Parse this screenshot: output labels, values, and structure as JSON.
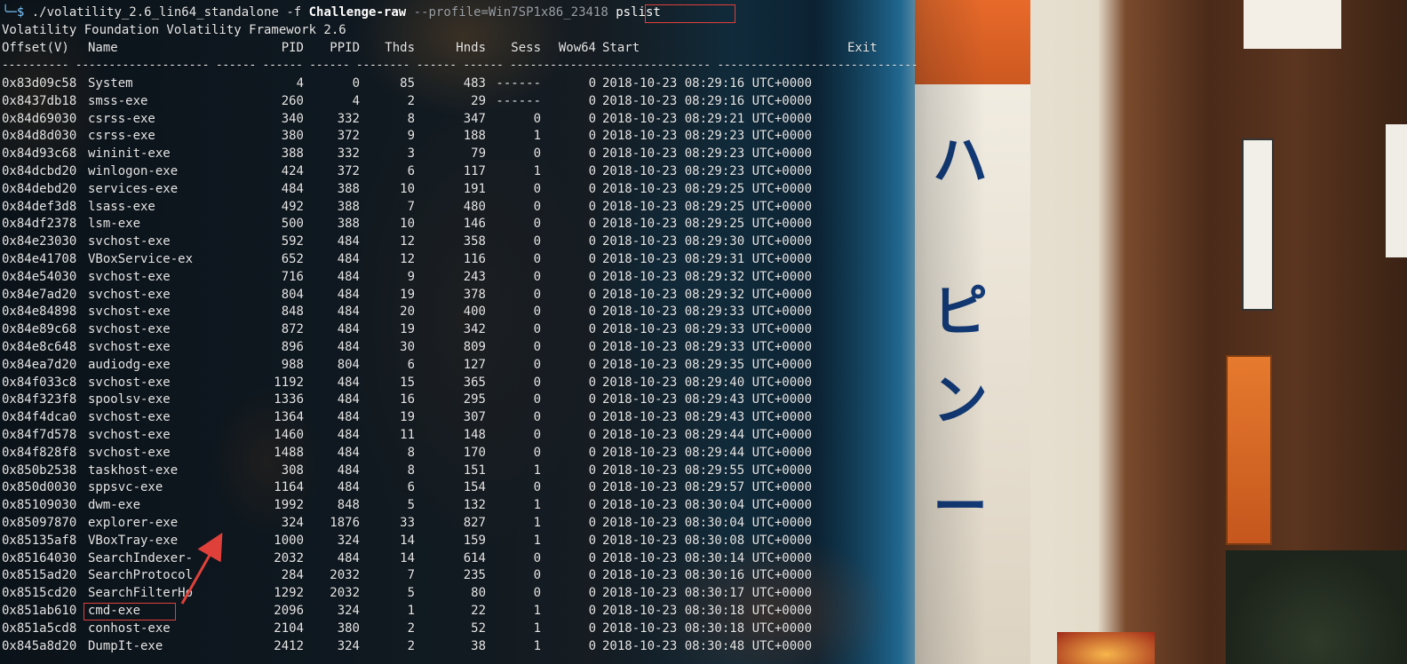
{
  "prompt": {
    "symbol": "╰─$",
    "executable": "./volatility_2.6_lin64_standalone",
    "flag_f": "-f",
    "file": "Challenge-raw",
    "profile_arg": "--profile=Win7SP1x86_23418",
    "plugin": "pslist"
  },
  "banner": "Volatility Foundation Volatility Framework 2.6",
  "headers": {
    "offset": "Offset(V)",
    "name": "Name",
    "pid": "PID",
    "ppid": "PPID",
    "thds": "Thds",
    "hnds": "Hnds",
    "sess": "Sess",
    "wow64": "Wow64",
    "start": "Start",
    "exit": "Exit"
  },
  "separator": "---------- -------------------- ------ ------ ------ -------- ------ ------ ------------------------------ ------------------------------",
  "processes": [
    {
      "offset": "0x83d09c58",
      "name": "System",
      "pid": "4",
      "ppid": "0",
      "thds": "85",
      "hnds": "483",
      "sess": "------",
      "wow64": "0",
      "start": "2018-10-23 08:29:16 UTC+0000"
    },
    {
      "offset": "0x8437db18",
      "name": "smss-exe",
      "pid": "260",
      "ppid": "4",
      "thds": "2",
      "hnds": "29",
      "sess": "------",
      "wow64": "0",
      "start": "2018-10-23 08:29:16 UTC+0000"
    },
    {
      "offset": "0x84d69030",
      "name": "csrss-exe",
      "pid": "340",
      "ppid": "332",
      "thds": "8",
      "hnds": "347",
      "sess": "0",
      "wow64": "0",
      "start": "2018-10-23 08:29:21 UTC+0000"
    },
    {
      "offset": "0x84d8d030",
      "name": "csrss-exe",
      "pid": "380",
      "ppid": "372",
      "thds": "9",
      "hnds": "188",
      "sess": "1",
      "wow64": "0",
      "start": "2018-10-23 08:29:23 UTC+0000"
    },
    {
      "offset": "0x84d93c68",
      "name": "wininit-exe",
      "pid": "388",
      "ppid": "332",
      "thds": "3",
      "hnds": "79",
      "sess": "0",
      "wow64": "0",
      "start": "2018-10-23 08:29:23 UTC+0000"
    },
    {
      "offset": "0x84dcbd20",
      "name": "winlogon-exe",
      "pid": "424",
      "ppid": "372",
      "thds": "6",
      "hnds": "117",
      "sess": "1",
      "wow64": "0",
      "start": "2018-10-23 08:29:23 UTC+0000"
    },
    {
      "offset": "0x84debd20",
      "name": "services-exe",
      "pid": "484",
      "ppid": "388",
      "thds": "10",
      "hnds": "191",
      "sess": "0",
      "wow64": "0",
      "start": "2018-10-23 08:29:25 UTC+0000"
    },
    {
      "offset": "0x84def3d8",
      "name": "lsass-exe",
      "pid": "492",
      "ppid": "388",
      "thds": "7",
      "hnds": "480",
      "sess": "0",
      "wow64": "0",
      "start": "2018-10-23 08:29:25 UTC+0000"
    },
    {
      "offset": "0x84df2378",
      "name": "lsm-exe",
      "pid": "500",
      "ppid": "388",
      "thds": "10",
      "hnds": "146",
      "sess": "0",
      "wow64": "0",
      "start": "2018-10-23 08:29:25 UTC+0000"
    },
    {
      "offset": "0x84e23030",
      "name": "svchost-exe",
      "pid": "592",
      "ppid": "484",
      "thds": "12",
      "hnds": "358",
      "sess": "0",
      "wow64": "0",
      "start": "2018-10-23 08:29:30 UTC+0000"
    },
    {
      "offset": "0x84e41708",
      "name": "VBoxService-ex",
      "pid": "652",
      "ppid": "484",
      "thds": "12",
      "hnds": "116",
      "sess": "0",
      "wow64": "0",
      "start": "2018-10-23 08:29:31 UTC+0000"
    },
    {
      "offset": "0x84e54030",
      "name": "svchost-exe",
      "pid": "716",
      "ppid": "484",
      "thds": "9",
      "hnds": "243",
      "sess": "0",
      "wow64": "0",
      "start": "2018-10-23 08:29:32 UTC+0000"
    },
    {
      "offset": "0x84e7ad20",
      "name": "svchost-exe",
      "pid": "804",
      "ppid": "484",
      "thds": "19",
      "hnds": "378",
      "sess": "0",
      "wow64": "0",
      "start": "2018-10-23 08:29:32 UTC+0000"
    },
    {
      "offset": "0x84e84898",
      "name": "svchost-exe",
      "pid": "848",
      "ppid": "484",
      "thds": "20",
      "hnds": "400",
      "sess": "0",
      "wow64": "0",
      "start": "2018-10-23 08:29:33 UTC+0000"
    },
    {
      "offset": "0x84e89c68",
      "name": "svchost-exe",
      "pid": "872",
      "ppid": "484",
      "thds": "19",
      "hnds": "342",
      "sess": "0",
      "wow64": "0",
      "start": "2018-10-23 08:29:33 UTC+0000"
    },
    {
      "offset": "0x84e8c648",
      "name": "svchost-exe",
      "pid": "896",
      "ppid": "484",
      "thds": "30",
      "hnds": "809",
      "sess": "0",
      "wow64": "0",
      "start": "2018-10-23 08:29:33 UTC+0000"
    },
    {
      "offset": "0x84ea7d20",
      "name": "audiodg-exe",
      "pid": "988",
      "ppid": "804",
      "thds": "6",
      "hnds": "127",
      "sess": "0",
      "wow64": "0",
      "start": "2018-10-23 08:29:35 UTC+0000"
    },
    {
      "offset": "0x84f033c8",
      "name": "svchost-exe",
      "pid": "1192",
      "ppid": "484",
      "thds": "15",
      "hnds": "365",
      "sess": "0",
      "wow64": "0",
      "start": "2018-10-23 08:29:40 UTC+0000"
    },
    {
      "offset": "0x84f323f8",
      "name": "spoolsv-exe",
      "pid": "1336",
      "ppid": "484",
      "thds": "16",
      "hnds": "295",
      "sess": "0",
      "wow64": "0",
      "start": "2018-10-23 08:29:43 UTC+0000"
    },
    {
      "offset": "0x84f4dca0",
      "name": "svchost-exe",
      "pid": "1364",
      "ppid": "484",
      "thds": "19",
      "hnds": "307",
      "sess": "0",
      "wow64": "0",
      "start": "2018-10-23 08:29:43 UTC+0000"
    },
    {
      "offset": "0x84f7d578",
      "name": "svchost-exe",
      "pid": "1460",
      "ppid": "484",
      "thds": "11",
      "hnds": "148",
      "sess": "0",
      "wow64": "0",
      "start": "2018-10-23 08:29:44 UTC+0000"
    },
    {
      "offset": "0x84f828f8",
      "name": "svchost-exe",
      "pid": "1488",
      "ppid": "484",
      "thds": "8",
      "hnds": "170",
      "sess": "0",
      "wow64": "0",
      "start": "2018-10-23 08:29:44 UTC+0000"
    },
    {
      "offset": "0x850b2538",
      "name": "taskhost-exe",
      "pid": "308",
      "ppid": "484",
      "thds": "8",
      "hnds": "151",
      "sess": "1",
      "wow64": "0",
      "start": "2018-10-23 08:29:55 UTC+0000"
    },
    {
      "offset": "0x850d0030",
      "name": "sppsvc-exe",
      "pid": "1164",
      "ppid": "484",
      "thds": "6",
      "hnds": "154",
      "sess": "0",
      "wow64": "0",
      "start": "2018-10-23 08:29:57 UTC+0000"
    },
    {
      "offset": "0x85109030",
      "name": "dwm-exe",
      "pid": "1992",
      "ppid": "848",
      "thds": "5",
      "hnds": "132",
      "sess": "1",
      "wow64": "0",
      "start": "2018-10-23 08:30:04 UTC+0000"
    },
    {
      "offset": "0x85097870",
      "name": "explorer-exe",
      "pid": "324",
      "ppid": "1876",
      "thds": "33",
      "hnds": "827",
      "sess": "1",
      "wow64": "0",
      "start": "2018-10-23 08:30:04 UTC+0000"
    },
    {
      "offset": "0x85135af8",
      "name": "VBoxTray-exe",
      "pid": "1000",
      "ppid": "324",
      "thds": "14",
      "hnds": "159",
      "sess": "1",
      "wow64": "0",
      "start": "2018-10-23 08:30:08 UTC+0000"
    },
    {
      "offset": "0x85164030",
      "name": "SearchIndexer-",
      "pid": "2032",
      "ppid": "484",
      "thds": "14",
      "hnds": "614",
      "sess": "0",
      "wow64": "0",
      "start": "2018-10-23 08:30:14 UTC+0000"
    },
    {
      "offset": "0x8515ad20",
      "name": "SearchProtocol",
      "pid": "284",
      "ppid": "2032",
      "thds": "7",
      "hnds": "235",
      "sess": "0",
      "wow64": "0",
      "start": "2018-10-23 08:30:16 UTC+0000"
    },
    {
      "offset": "0x8515cd20",
      "name": "SearchFilterHo",
      "pid": "1292",
      "ppid": "2032",
      "thds": "5",
      "hnds": "80",
      "sess": "0",
      "wow64": "0",
      "start": "2018-10-23 08:30:17 UTC+0000"
    },
    {
      "offset": "0x851ab610",
      "name": "cmd-exe",
      "pid": "2096",
      "ppid": "324",
      "thds": "1",
      "hnds": "22",
      "sess": "1",
      "wow64": "0",
      "start": "2018-10-23 08:30:18 UTC+0000"
    },
    {
      "offset": "0x851a5cd8",
      "name": "conhost-exe",
      "pid": "2104",
      "ppid": "380",
      "thds": "2",
      "hnds": "52",
      "sess": "1",
      "wow64": "0",
      "start": "2018-10-23 08:30:18 UTC+0000"
    },
    {
      "offset": "0x845a8d20",
      "name": "DumpIt-exe",
      "pid": "2412",
      "ppid": "324",
      "thds": "2",
      "hnds": "38",
      "sess": "1",
      "wow64": "0",
      "start": "2018-10-23 08:30:48 UTC+0000"
    }
  ],
  "annotation": {
    "highlighted_process": "cmd-exe",
    "highlight_color": "#e0403a"
  },
  "colors": {
    "terminal_text": "#e6e6e6",
    "prompt_arrow": "#7ec8ff",
    "profile_text": "#9aa0a6"
  }
}
